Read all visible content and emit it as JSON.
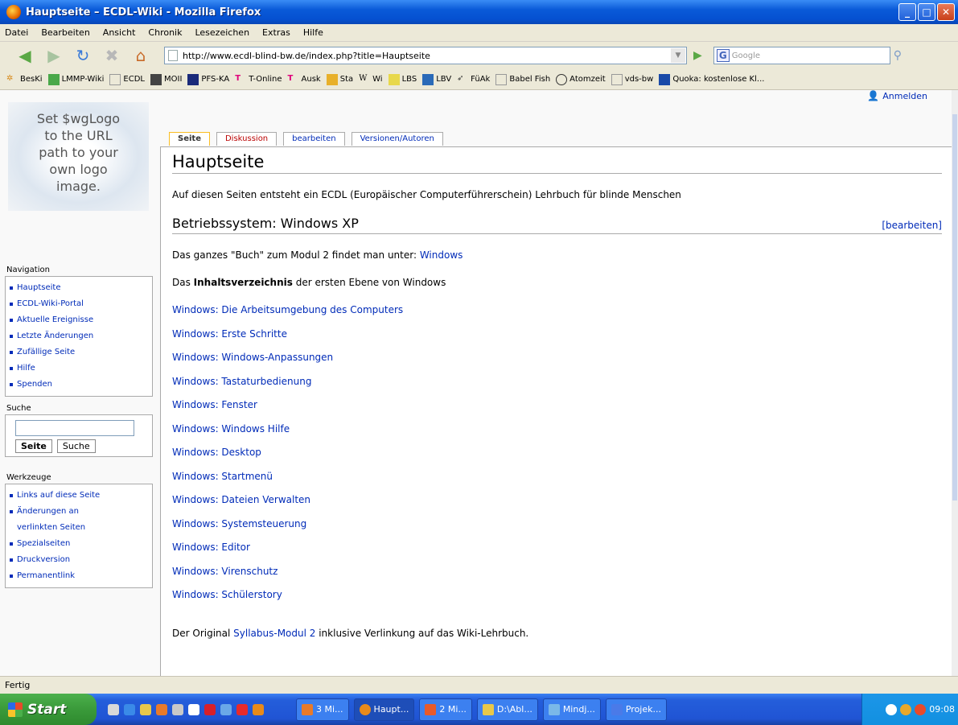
{
  "window": {
    "title": "Hauptseite – ECDL-Wiki - Mozilla Firefox"
  },
  "menu": [
    "Datei",
    "Bearbeiten",
    "Ansicht",
    "Chronik",
    "Lesezeichen",
    "Extras",
    "Hilfe"
  ],
  "nav": {
    "url": "http://www.ecdl-blind-bw.de/index.php?title=Hauptseite",
    "search_placeholder": "Google"
  },
  "bookmarks": [
    "BesKi",
    "LMMP-Wiki",
    "ECDL",
    "MOII",
    "PFS-KA",
    "T-Online",
    "Ausk",
    "Sta",
    "Wi",
    "LBS",
    "LBV",
    "FüAk",
    "Babel Fish",
    "Atomzeit",
    "vds-bw",
    "Quoka: kostenlose Kl..."
  ],
  "logo_text": [
    "Set $wgLogo",
    "to the URL",
    "path to your",
    "own logo",
    "image."
  ],
  "personal": {
    "login": "Anmelden"
  },
  "tabs": [
    "Seite",
    "Diskussion",
    "bearbeiten",
    "Versionen/Autoren"
  ],
  "sidebar": {
    "navigation": {
      "title": "Navigation",
      "items": [
        "Hauptseite",
        "ECDL-Wiki-Portal",
        "Aktuelle Ereignisse",
        "Letzte Änderungen",
        "Zufällige Seite",
        "Hilfe",
        "Spenden"
      ]
    },
    "search": {
      "title": "Suche",
      "btn_go": "Seite",
      "btn_search": "Suche"
    },
    "tools": {
      "title": "Werkzeuge",
      "items": [
        "Links auf diese Seite",
        "Änderungen an",
        "verlinkten Seiten",
        "Spezialseiten",
        "Druckversion",
        "Permanentlink"
      ]
    }
  },
  "content": {
    "heading": "Hauptseite",
    "intro": "Auf diesen Seiten entsteht ein ECDL (Europäischer Computerführerschein) Lehrbuch für blinde Menschen",
    "section_title": "Betriebssystem: Windows XP",
    "section_edit": "[bearbeiten]",
    "p1_text": "Das ganzes \"Buch\" zum Modul 2 findet man unter: ",
    "p1_link": "Windows",
    "p2_pre": "Das ",
    "p2_bold": "Inhaltsverzeichnis",
    "p2_post": " der ersten Ebene von Windows",
    "links": [
      "Windows: Die Arbeitsumgebung des Computers",
      "Windows: Erste Schritte",
      "Windows: Windows-Anpassungen",
      "Windows: Tastaturbedienung",
      "Windows: Fenster",
      "Windows: Windows Hilfe",
      "Windows: Desktop",
      "Windows: Startmenü",
      "Windows: Dateien Verwalten",
      "Windows: Systemsteuerung",
      "Windows: Editor",
      "Windows: Virenschutz",
      "Windows: Schülerstory"
    ],
    "last_pre": "Der Original ",
    "last_link": "Syllabus-Modul 2",
    "last_post": " inklusive Verlinkung auf das Wiki-Lehrbuch."
  },
  "status": "Fertig",
  "taskbar": {
    "start": "Start",
    "tasks": [
      "3 Mi...",
      "Haupt...",
      "2 Mi...",
      "D:\\Abl...",
      "Mindj...",
      "Projek..."
    ],
    "clock": "09:08"
  }
}
